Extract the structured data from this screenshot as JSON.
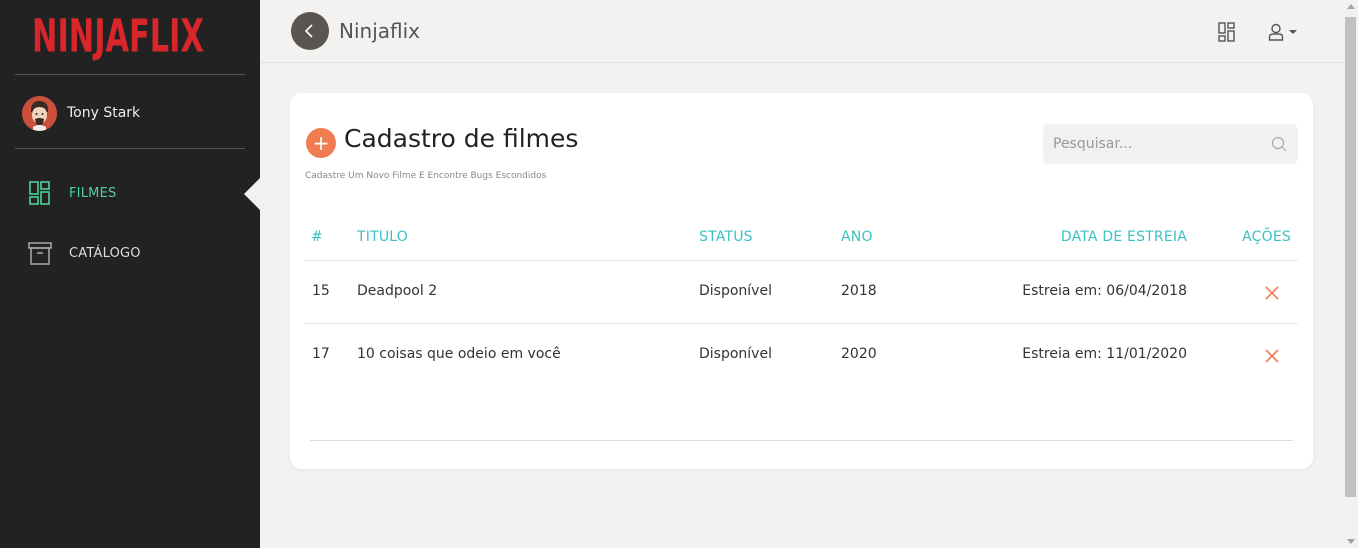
{
  "app": {
    "logo_text": "NINJAFLIX",
    "title": "Ninjaflix"
  },
  "colors": {
    "sidebar_bg": "#222222",
    "brand_red": "#d8262b",
    "active_green": "#4ed29b",
    "header_teal": "#3bc1c3",
    "accent_orange": "#f07d52"
  },
  "user": {
    "name": "Tony Stark"
  },
  "sidebar": {
    "items": [
      {
        "label": "FILMES",
        "icon": "dashboard-grid-icon",
        "active": true
      },
      {
        "label": "CATÁLOGO",
        "icon": "archive-box-icon",
        "active": false
      }
    ]
  },
  "header": {
    "title": "Ninjaflix",
    "icons": [
      "back-arrow-icon",
      "dashboard-grid-icon",
      "user-icon",
      "caret-down-icon"
    ]
  },
  "page": {
    "title": "Cadastro de filmes",
    "subtitle": "Cadastre Um Novo Filme E Encontre Bugs Escondidos",
    "add_label": "+",
    "search_placeholder": "Pesquisar..."
  },
  "table": {
    "columns": {
      "id": "#",
      "title": "TITULO",
      "status": "STATUS",
      "year": "ANO",
      "premiere": "DATA DE ESTREIA",
      "actions": "AÇÕES"
    },
    "rows": [
      {
        "id": "15",
        "title": "Deadpool 2",
        "status": "Disponível",
        "year": "2018",
        "premiere": "Estreia em: 06/04/2018"
      },
      {
        "id": "17",
        "title": "10 coisas que odeio em você",
        "status": "Disponível",
        "year": "2020",
        "premiere": "Estreia em: 11/01/2020"
      }
    ]
  }
}
